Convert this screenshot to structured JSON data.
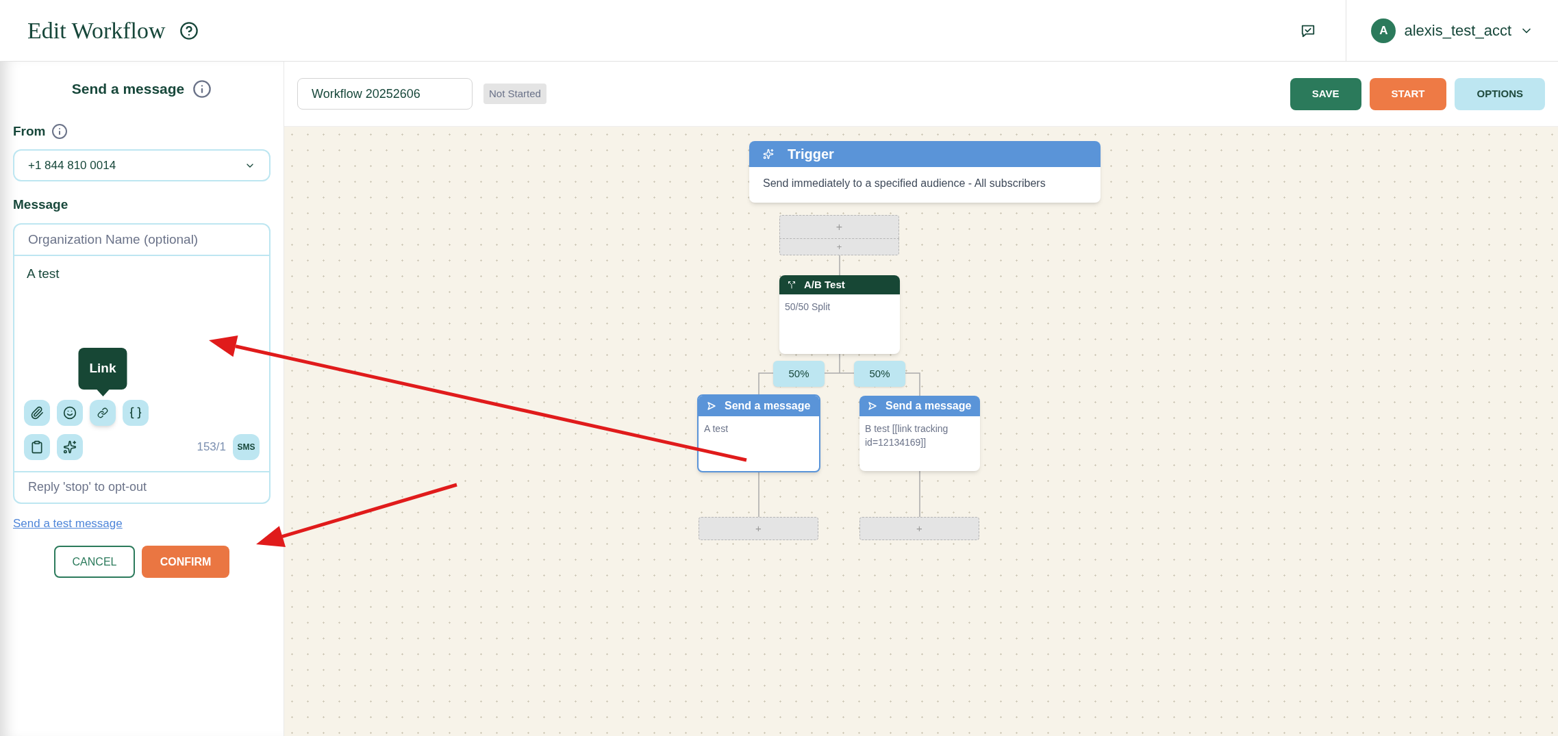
{
  "header": {
    "title": "Edit Workflow",
    "account": {
      "initial": "A",
      "name": "alexis_test_acct"
    }
  },
  "panel": {
    "title": "Send a message",
    "from_label": "From",
    "from_value": "+1 844 810 0014",
    "message_label": "Message",
    "org_placeholder": "Organization Name (optional)",
    "message_value": "A test",
    "tooltip": "Link",
    "counter": "153/1",
    "channel": "SMS",
    "footer_text": "Reply 'stop' to opt-out",
    "test_link": "Send a test message",
    "cancel": "CANCEL",
    "confirm": "CONFIRM"
  },
  "toolbar": {
    "workflow_name": "Workflow 20252606",
    "status": "Not Started",
    "buttons": [
      {
        "label": "SAVE",
        "kind": "save"
      },
      {
        "label": "START",
        "kind": "start"
      },
      {
        "label": "OPTIONS",
        "kind": "options"
      }
    ]
  },
  "canvas": {
    "trigger": {
      "title": "Trigger",
      "description": "Send immediately to a specified audience - All subscribers"
    },
    "top_slot": [
      "+",
      "+"
    ],
    "ab_test": {
      "title": "A/B Test",
      "description": "50/50 Split"
    },
    "branches": [
      {
        "percent": "50%",
        "node": {
          "title": "Send a message",
          "body": "A test",
          "selected": true
        },
        "slot": "+"
      },
      {
        "percent": "50%",
        "node": {
          "title": "Send a message",
          "body": "B test [[link tracking id=12134169]]",
          "selected": false
        },
        "slot": "+"
      }
    ]
  }
}
